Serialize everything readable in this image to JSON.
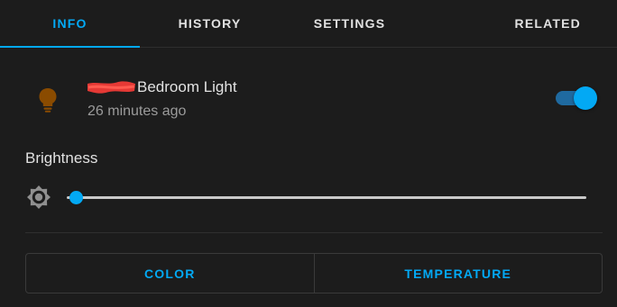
{
  "tabs": [
    {
      "label": "INFO",
      "active": true
    },
    {
      "label": "HISTORY",
      "active": false
    },
    {
      "label": "SETTINGS",
      "active": false
    },
    {
      "label": "RELATED",
      "active": false
    }
  ],
  "entity": {
    "icon": "lightbulb-icon",
    "icon_color": "#8a4b00",
    "name": "Bedroom Light",
    "last_changed": "26 minutes ago",
    "state_on": true
  },
  "brightness": {
    "label": "Brightness",
    "icon": "brightness-icon",
    "value_fraction": 0.01
  },
  "actions": {
    "color_label": "COLOR",
    "temperature_label": "TEMPERATURE"
  },
  "colors": {
    "accent": "#03a9f4",
    "background": "#1c1c1c",
    "redaction": "#e53935"
  }
}
